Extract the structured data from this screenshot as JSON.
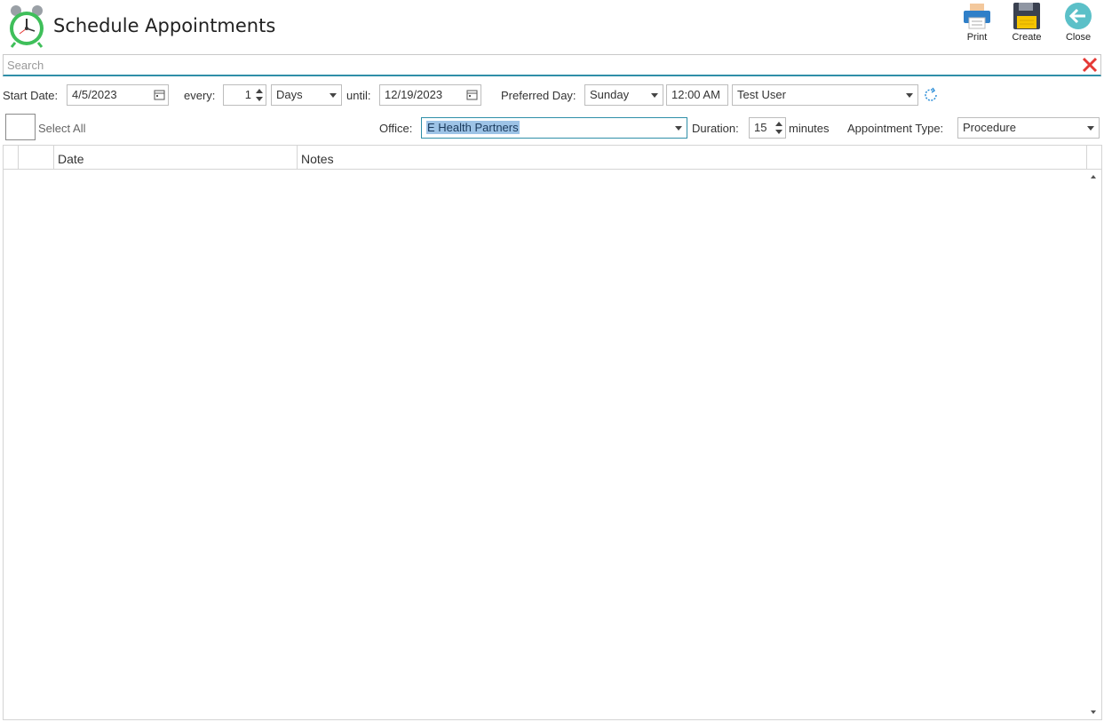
{
  "header": {
    "title": "Schedule Appointments",
    "app_icon": "alarm-clock-icon",
    "tools": [
      {
        "label": "Print",
        "icon": "printer-icon"
      },
      {
        "label": "Create",
        "icon": "floppy-disk-icon"
      },
      {
        "label": "Close",
        "icon": "back-arrow-icon"
      }
    ]
  },
  "search": {
    "placeholder": "Search",
    "value": "",
    "clear_icon": "red-x-icon"
  },
  "schedule": {
    "start_date_label": "Start Date:",
    "start_date": "4/5/2023",
    "every_label": "every:",
    "every_value": "1",
    "interval_unit": "Days",
    "until_label": "until:",
    "until_date": "12/19/2023",
    "preferred_day_label": "Preferred Day:",
    "preferred_day": "Sunday",
    "time": "12:00 AM",
    "user": "Test User"
  },
  "options": {
    "select_all_label": "Select All",
    "office_label": "Office:",
    "office": "E Health Partners",
    "duration_label": "Duration:",
    "duration": "15",
    "duration_unit": "minutes",
    "appointment_type_label": "Appointment Type:",
    "appointment_type": "Procedure"
  },
  "grid": {
    "columns": [
      "",
      "Date",
      "Notes"
    ],
    "rows": []
  },
  "colors": {
    "accent": "#2f8fa8",
    "selection": "#9dc3e6",
    "clear_red": "#e53935",
    "clock_green": "#3fbf5a",
    "close_teal": "#5bc0c8"
  }
}
